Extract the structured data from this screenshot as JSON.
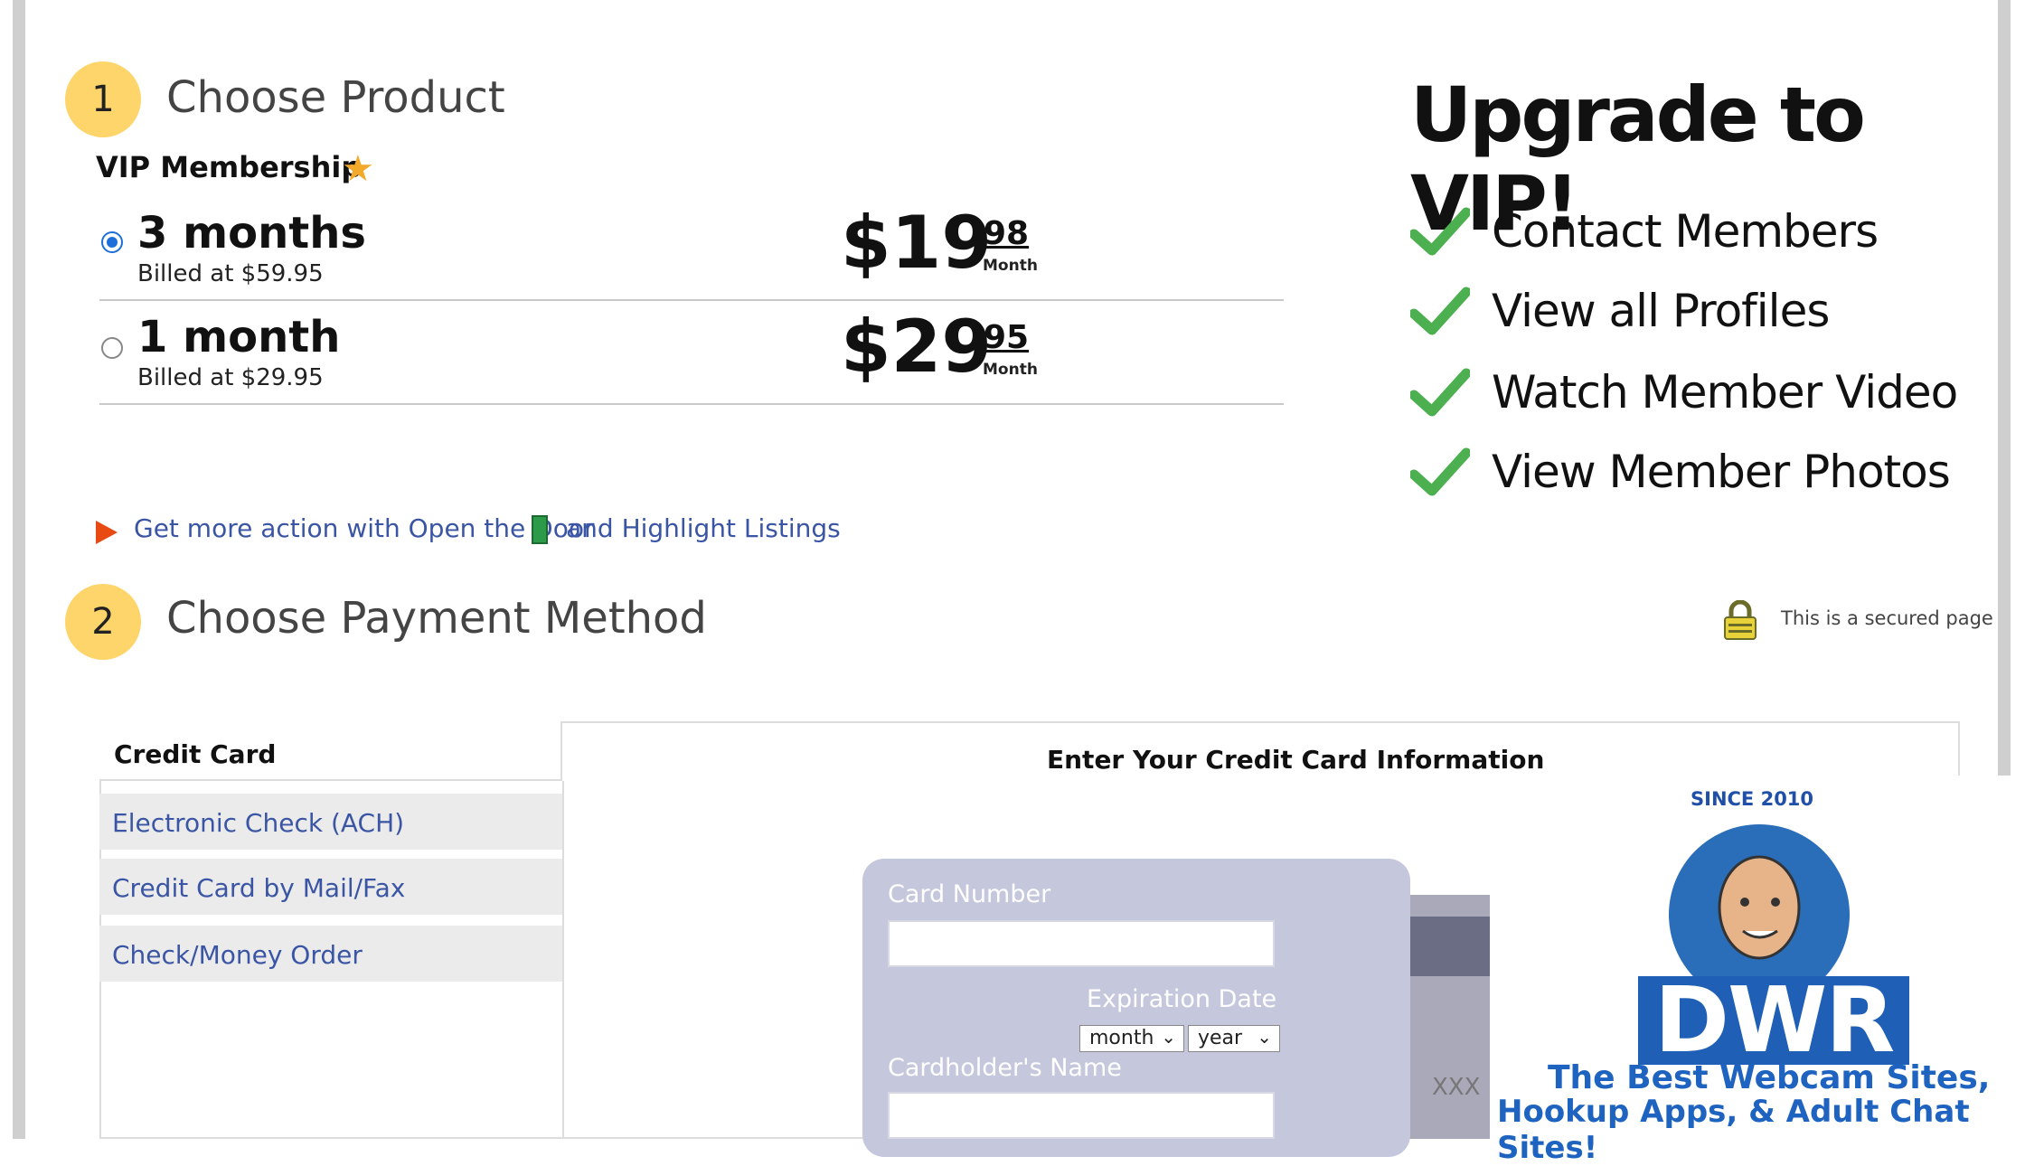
{
  "step1": {
    "number": "1",
    "title": "Choose Product"
  },
  "product": {
    "membership_label": "VIP Membership",
    "star_icon": "star-icon",
    "plans": [
      {
        "name": "3 months",
        "billed": "Billed at $59.95",
        "price_dollars": "$19",
        "price_cents": "98",
        "price_period": "Month",
        "selected": true
      },
      {
        "name": "1 month",
        "billed": "Billed at $29.95",
        "price_dollars": "$29",
        "price_cents": "95",
        "price_period": "Month",
        "selected": false
      }
    ]
  },
  "promo": {
    "text_part1": "Get more action with Open the Door",
    "text_part2": "and Highlight Listings",
    "arrow_icon": "play-arrow-icon",
    "door_icon": "door-icon"
  },
  "upgrade": {
    "title": "Upgrade to VIP!",
    "benefits": [
      "Contact Members",
      "View all Profiles",
      "Watch Member Video",
      "View Member Photos"
    ],
    "check_color": "#4caf50"
  },
  "step2": {
    "number": "2",
    "title": "Choose Payment Method"
  },
  "secure": {
    "text": "This is a secured page",
    "icon": "lock-icon"
  },
  "payment": {
    "tabs": [
      "Credit Card",
      "Electronic Check (ACH)",
      "Credit Card by Mail/Fax",
      "Check/Money Order"
    ],
    "active_tab": "Credit Card",
    "form_title": "Enter Your Credit Card Information",
    "card_number_label": "Card Number",
    "expiration_label": "Expiration Date",
    "month_value": "month",
    "year_value": "year",
    "cardholder_label": "Cardholder's Name",
    "card_back_text": "XXX"
  },
  "badge": {
    "since": "SINCE 2010",
    "logo": "DWR",
    "line1": "The Best Webcam Sites,",
    "line2": "Hookup Apps, & Adult Chat Sites!"
  },
  "colors": {
    "step_circle": "#fdd56a",
    "link": "#3a55a4",
    "accent": "#1f63c0"
  }
}
